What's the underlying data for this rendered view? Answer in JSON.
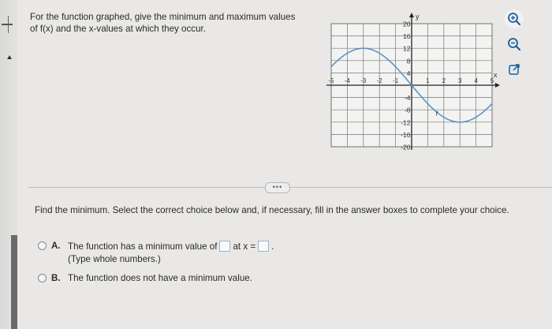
{
  "question": {
    "line1": "For the function graphed, give the minimum and maximum values",
    "line2": "of f(x) and the x-values at which they occur."
  },
  "graph": {
    "y_axis_label": "y",
    "x_axis_label": "x",
    "y_tick_labels": [
      "20",
      "16",
      "12",
      "8",
      "4",
      "-4",
      "-8",
      "-12",
      "-16",
      "-20"
    ],
    "x_tick_labels": [
      "-5",
      "-4",
      "-3",
      "-2",
      "-1",
      "1",
      "2",
      "3",
      "4",
      "5"
    ],
    "curve_label": "f",
    "curve": "sine wave: rising from y=4 at x=-5 to a maximum of 12 at x=-3, falling through 4 at x=-1 and -4 at x=1, to a minimum of -12 at x=3, rising to -4 at x=5"
  },
  "tools": {
    "zoom_in": "zoom-in",
    "zoom_out": "zoom-out",
    "open_new": "open-in-new-window"
  },
  "divider": {
    "dots": "•••"
  },
  "prompt": "Find the minimum. Select the correct choice below and, if necessary, fill in the answer boxes to complete your choice.",
  "choices": {
    "a": {
      "letter": "A.",
      "text_before": "The function has a minimum value of",
      "text_middle": "at x =",
      "text_after": ".",
      "hint": "(Type whole numbers.)",
      "value": "",
      "x_value": ""
    },
    "b": {
      "letter": "B.",
      "text": "The function does not have a minimum value."
    }
  },
  "colors": {
    "curve": "#5b95c9",
    "radio_border": "#7d8a9a",
    "accent": "#1a5f9e"
  }
}
